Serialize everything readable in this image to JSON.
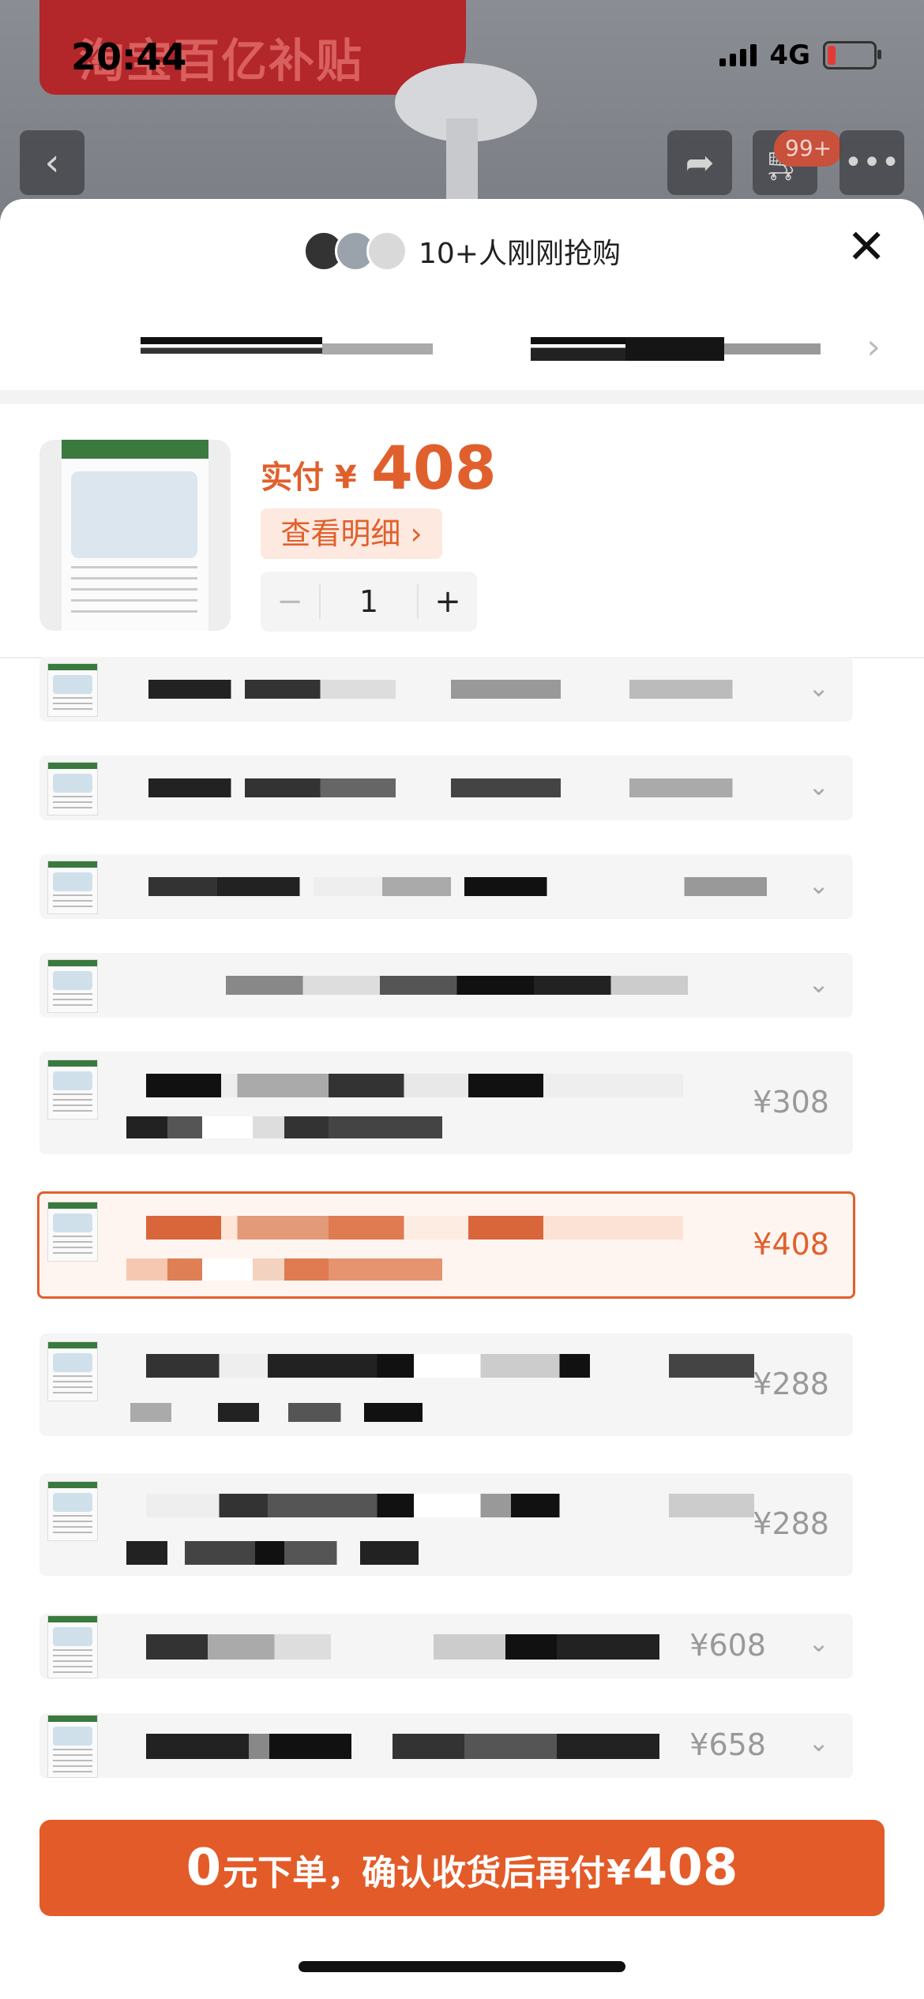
{
  "status_bar": {
    "time": "20:44",
    "network": "4G"
  },
  "background": {
    "banner_text": "淘宝百亿补贴",
    "cart_badge": "99+"
  },
  "sheet": {
    "buyers_text": "10+人刚刚抢购",
    "price_label": "实付 ¥",
    "price_value": "408",
    "detail_button": "查看明细 ›",
    "quantity": "1",
    "minus": "−",
    "plus": "+",
    "close": "✕"
  },
  "options": [
    {
      "price": "",
      "has_chevron": true
    },
    {
      "price": "",
      "has_chevron": true
    },
    {
      "price": "",
      "has_chevron": true
    },
    {
      "price": "",
      "has_chevron": true
    },
    {
      "price": "¥308",
      "has_chevron": false
    },
    {
      "price": "¥408",
      "has_chevron": false,
      "selected": true
    },
    {
      "price": "¥288",
      "has_chevron": false
    },
    {
      "price": "¥288",
      "has_chevron": false
    },
    {
      "price": "¥608",
      "has_chevron": true
    },
    {
      "price": "¥658",
      "has_chevron": true
    }
  ],
  "cta": {
    "zero": "0",
    "middle": "元下单，确认收货后再付",
    "currency": "¥",
    "amount": "408"
  },
  "colors": {
    "accent": "#e35b28",
    "price": "#e0602d",
    "selected_bg": "#fff5f0"
  }
}
